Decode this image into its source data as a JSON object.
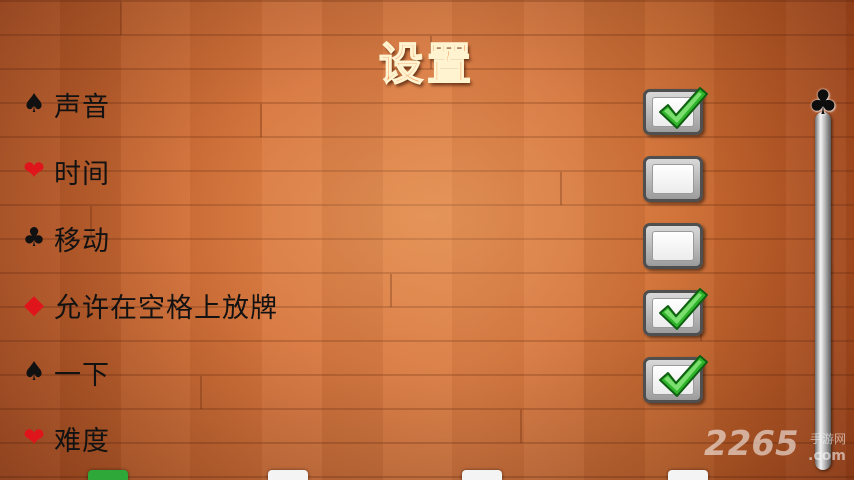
{
  "screen": {
    "title": "设置"
  },
  "settings": [
    {
      "suit": "♠",
      "suit_name": "spade-icon",
      "suit_color": "#111111",
      "label": "声音",
      "checked": true
    },
    {
      "suit": "❤",
      "suit_name": "heart-icon",
      "suit_color": "#e0141b",
      "label": "时间",
      "checked": false
    },
    {
      "suit": "♣",
      "suit_name": "club-icon",
      "suit_color": "#111111",
      "label": "移动",
      "checked": false
    },
    {
      "suit": "◆",
      "suit_name": "diamond-icon",
      "suit_color": "#e0141b",
      "label": "允许在空格上放牌",
      "checked": true
    },
    {
      "suit": "♠",
      "suit_name": "spade-icon",
      "suit_color": "#111111",
      "label": "一下",
      "checked": true
    },
    {
      "suit": "❤",
      "suit_name": "heart-icon",
      "suit_color": "#e0141b",
      "label": "难度"
    }
  ],
  "scrollbar": {
    "thumb_icon": "club-icon",
    "thumb_glyph": "♣"
  },
  "watermark": {
    "number": "2265",
    "site_cn": "手游网",
    "domain": ".com"
  },
  "colors": {
    "title": "#f06a1e",
    "check": "#2fb52a",
    "wood": "#c7622a"
  }
}
